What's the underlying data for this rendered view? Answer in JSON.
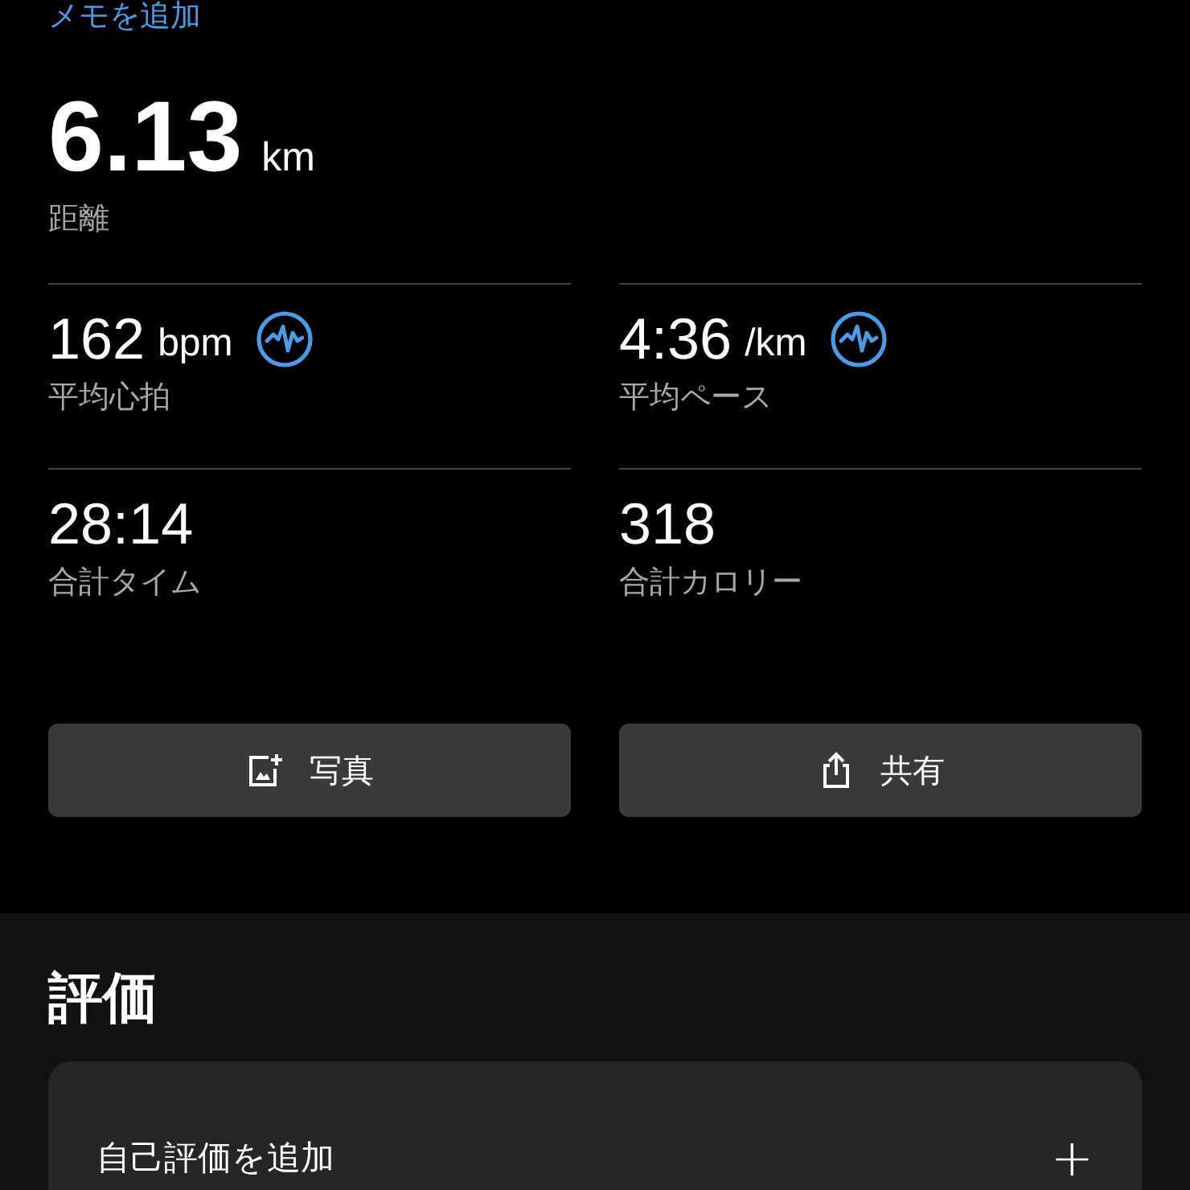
{
  "memo_link": "メモを追加",
  "distance": {
    "value": "6.13",
    "unit": "km",
    "label": "距離"
  },
  "stats": [
    {
      "value": "162",
      "unit": "bpm",
      "label": "平均心拍",
      "chart_icon": true
    },
    {
      "value": "4:36",
      "unit": "/km",
      "label": "平均ペース",
      "chart_icon": true
    },
    {
      "value": "28:14",
      "label": "合計タイム",
      "chart_icon": false
    },
    {
      "value": "318",
      "label": "合計カロリー",
      "chart_icon": false
    }
  ],
  "buttons": [
    {
      "kind": "photo",
      "label": "写真"
    },
    {
      "kind": "share",
      "label": "共有"
    }
  ],
  "rating": {
    "title": "評価",
    "row_label": "自己評価を追加",
    "row_action": "+"
  }
}
